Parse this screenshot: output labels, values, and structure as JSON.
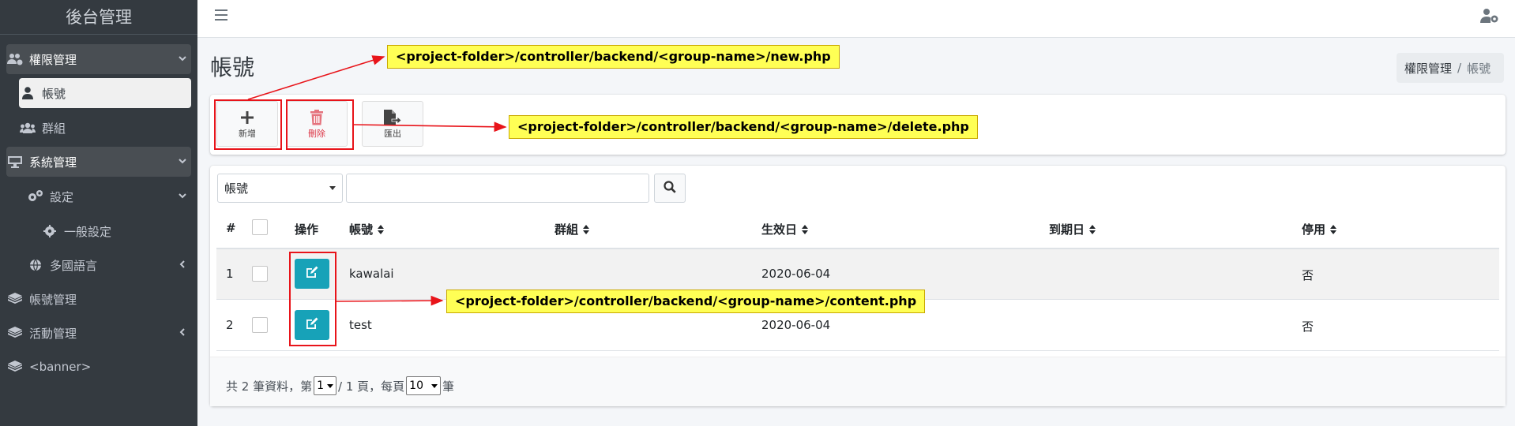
{
  "app": {
    "brand": "後台管理"
  },
  "sidebar": {
    "items": [
      {
        "label": "權限管理",
        "icon": "users-cog-icon",
        "caret": "expanded"
      },
      {
        "label": "帳號",
        "icon": "user-icon",
        "active": true
      },
      {
        "label": "群組",
        "icon": "users-icon"
      },
      {
        "label": "系統管理",
        "icon": "desktop-icon",
        "caret": "expanded"
      },
      {
        "label": "設定",
        "icon": "cogs-icon",
        "caret": "expanded"
      },
      {
        "label": "一般設定",
        "icon": "cog-icon"
      },
      {
        "label": "多國語言",
        "icon": "globe-icon",
        "caret": "collapsed"
      },
      {
        "label": "帳號管理",
        "icon": "layers-icon"
      },
      {
        "label": "活動管理",
        "icon": "layers-icon",
        "caret": "collapsed"
      },
      {
        "label": "<banner>",
        "icon": "layers-icon"
      }
    ]
  },
  "topbar": {
    "menu_icon": "hamburger-icon",
    "user_icon": "user-cog-icon"
  },
  "page": {
    "title": "帳號"
  },
  "breadcrumb": {
    "items": [
      "權限管理",
      "帳號"
    ],
    "separator": "/"
  },
  "toolbar": {
    "add_label": "新增",
    "delete_label": "刪除",
    "export_label": "匯出"
  },
  "search": {
    "field_selected": "帳號",
    "query": ""
  },
  "table": {
    "columns": {
      "index": "#",
      "actions": "操作",
      "account": "帳號",
      "group": "群組",
      "effective_date": "生效日",
      "expiry_date": "到期日",
      "disabled": "停用"
    },
    "rows": [
      {
        "index": "1",
        "account": "kawalai",
        "group": "",
        "effective_date": "2020-06-04",
        "expiry_date": "",
        "disabled": "否"
      },
      {
        "index": "2",
        "account": "test",
        "group": "",
        "effective_date": "2020-06-04",
        "expiry_date": "",
        "disabled": "否"
      }
    ]
  },
  "pager": {
    "prefix": "共 2 筆資料，第",
    "page_value": "1",
    "mid": "/ 1 頁，每頁",
    "per_page_value": "10",
    "suffix": "筆"
  },
  "annotations": {
    "new": "<project-folder>/controller/backend/<group-name>/new.php",
    "delete": "<project-folder>/controller/backend/<group-name>/delete.php",
    "content": "<project-folder>/controller/backend/<group-name>/content.php"
  },
  "colors": {
    "sidebar_bg": "#343a40",
    "info_button": "#17a2b8",
    "annotation_highlight": "#ffff55",
    "annotation_red": "#e8141a"
  }
}
